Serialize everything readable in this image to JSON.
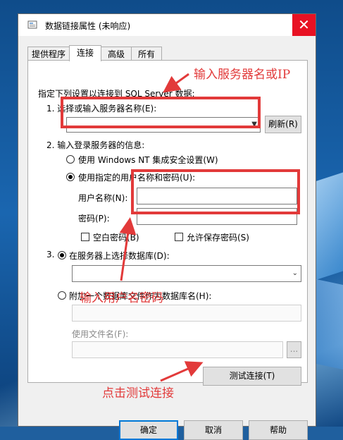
{
  "window": {
    "title": "数据链接属性 (未响应)",
    "close_glyph": "✕"
  },
  "tabs": [
    "提供程序",
    "连接",
    "高级",
    "所有"
  ],
  "connection": {
    "intro": "指定下列设置以连接到 SQL Server 数据:",
    "step1_label": "1. 选择或输入服务器名称(E):",
    "server_value": "",
    "refresh_label": "刷新(R)",
    "step2_label": "2. 输入登录服务器的信息:",
    "radio_windows": "使用 Windows NT 集成安全设置(W)",
    "radio_specific": "使用指定的用户名称和密码(U):",
    "username_label": "用户名称(N):",
    "username_value": "",
    "password_label": "密码(P):",
    "password_value": "",
    "blank_password": "空白密码(B)",
    "allow_save_password": "允许保存密码(S)",
    "step3_prefix": "3.",
    "radio_select_db": "在服务器上选择数据库(D):",
    "database_value": "",
    "radio_attach_file": "附加一个数据库文件作为数据库名(H):",
    "use_filename_label": "使用文件名(F):",
    "browse_label": "...",
    "test_connection": "测试连接(T)"
  },
  "footer": {
    "ok": "确定",
    "cancel": "取消",
    "help": "帮助"
  },
  "annotations": {
    "server_hint": "输入服务器名或IP",
    "credentials_hint": "输入用户名密码",
    "test_hint": "点击测试连接"
  },
  "colors": {
    "annotation": "#e23a3a",
    "close_button": "#e81123"
  }
}
